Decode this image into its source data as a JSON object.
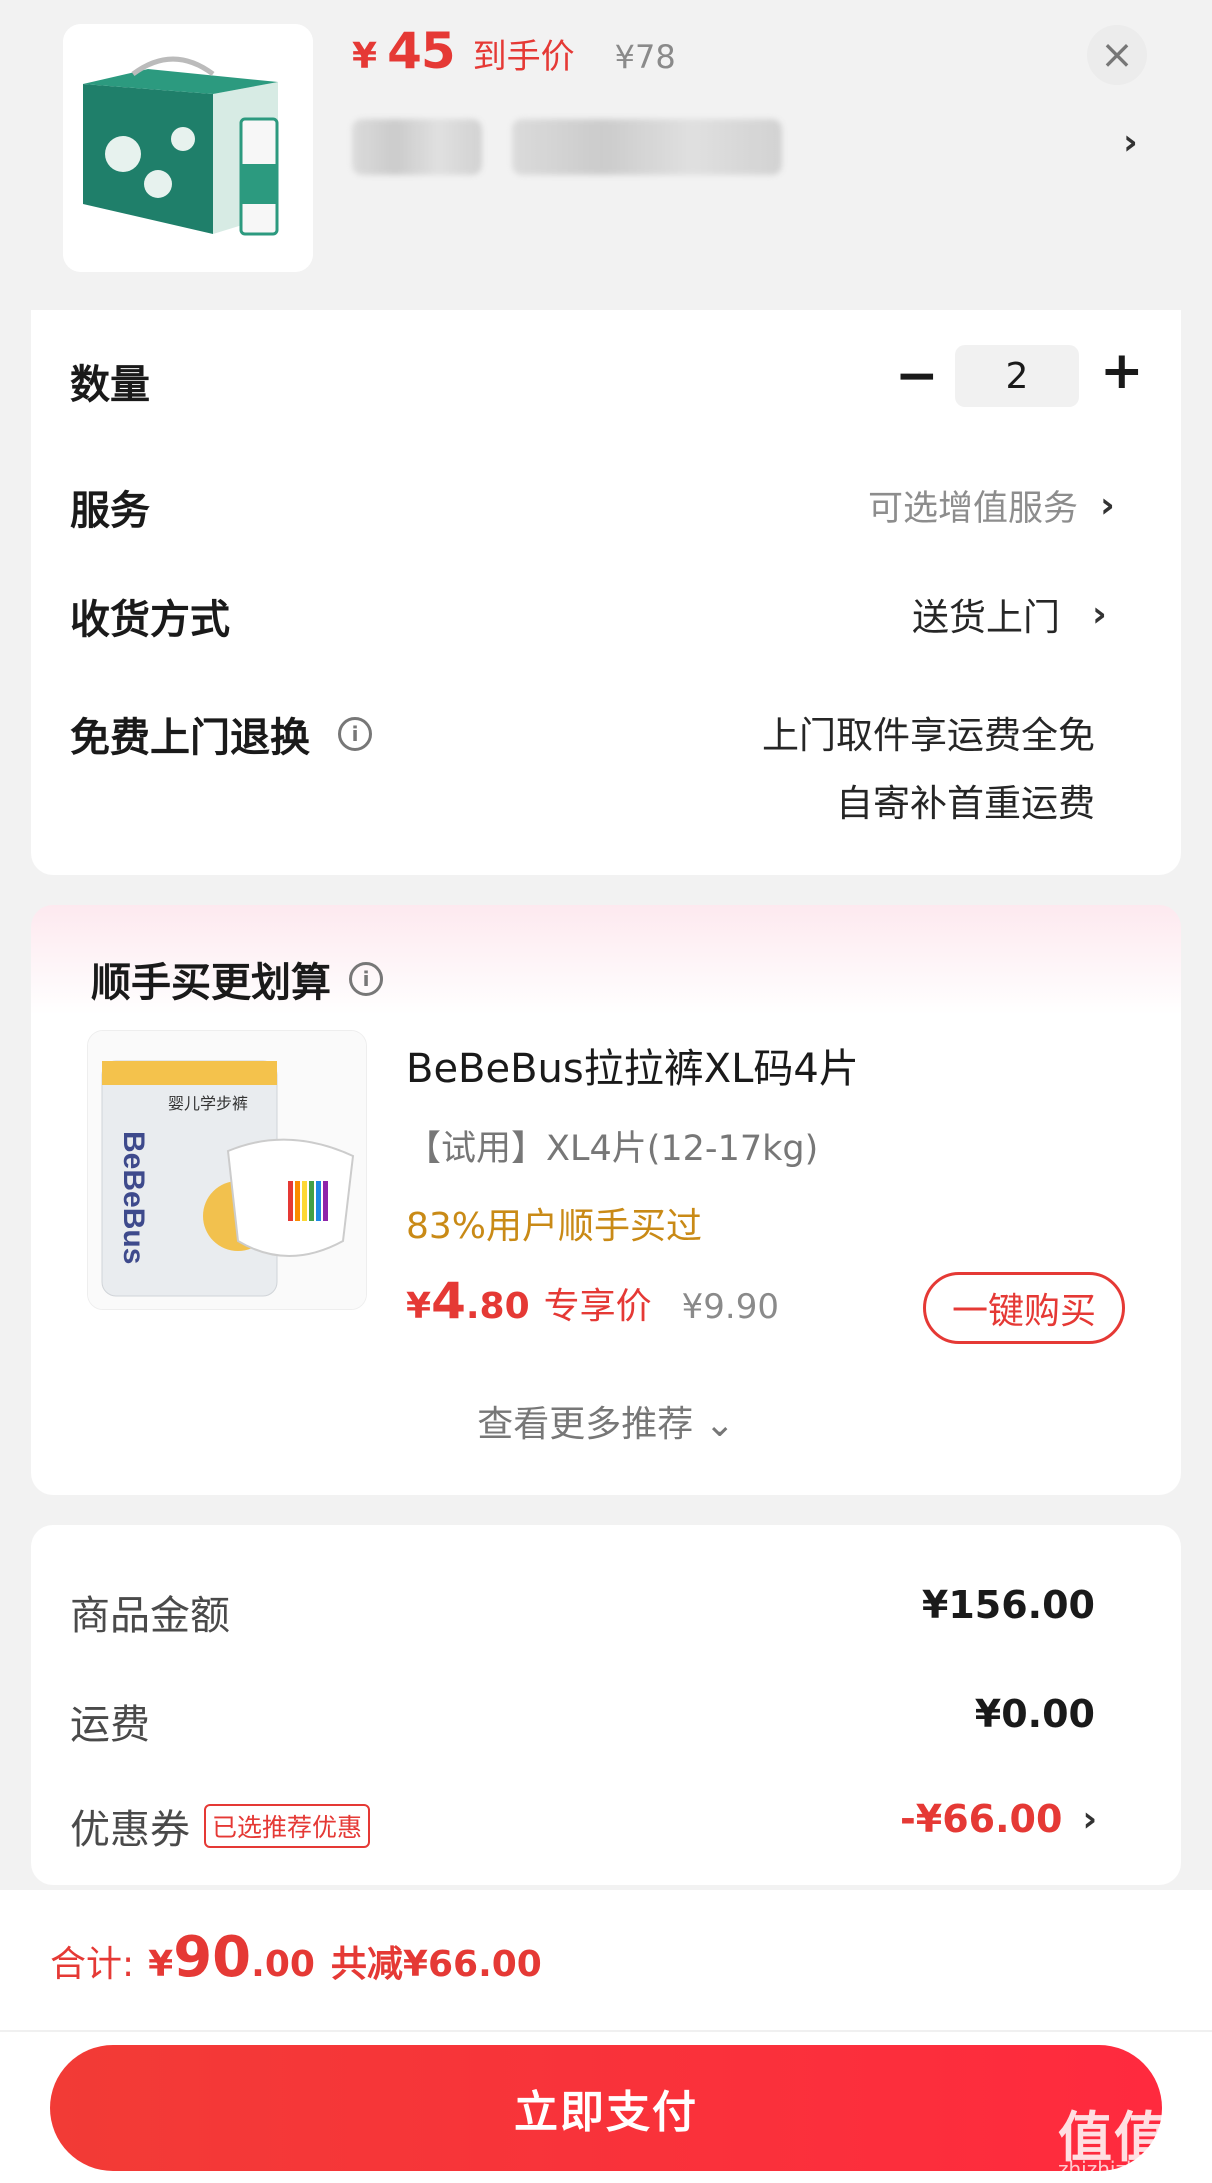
{
  "product": {
    "price_currency": "¥",
    "price": "45",
    "price_tag": "到手价",
    "original_price": "¥78",
    "close_icon": "close-icon",
    "chevron_icon": "chevron-right-icon"
  },
  "settings": {
    "quantity": {
      "label": "数量",
      "value": "2",
      "minus": "−",
      "plus": "+"
    },
    "service": {
      "label": "服务",
      "hint": "可选增值服务",
      "chevron": "›"
    },
    "delivery": {
      "label": "收货方式",
      "value": "送货上门",
      "chevron": "›"
    },
    "return": {
      "label": "免费上门退换",
      "line1": "上门取件享运费全免",
      "line2": "自寄补首重运费",
      "info": "i"
    }
  },
  "recommend": {
    "title": "顺手买更划算",
    "info": "i",
    "item": {
      "name": "BeBeBus拉拉裤XL码4片",
      "spec": "【试用】XL4片(12-17kg)",
      "users": "83%用户顺手买过",
      "price_cur": "¥",
      "price_int": "4",
      "price_dec": ".80",
      "price_tag": "专享价",
      "original_price": "¥9.90",
      "buy_label": "一键购买",
      "package_text_brand": "BeBeBus",
      "package_text_cn": "婴儿学步裤"
    },
    "more": "查看更多推荐 ⌄"
  },
  "amounts": {
    "goods": {
      "label": "商品金额",
      "value": "¥156.00"
    },
    "shipping": {
      "label": "运费",
      "value": "¥0.00"
    },
    "coupon": {
      "label": "优惠券",
      "badge": "已选推荐优惠",
      "value": "-¥66.00",
      "chevron": "›"
    }
  },
  "bottom": {
    "total_label": "合计:",
    "total_cur": "¥",
    "total_int": "90",
    "total_dec": ".00",
    "saved": "共减¥66.00",
    "pay_label": "立即支付",
    "watermark": "值值值",
    "watermark_sub": "zhizhizhi.com"
  },
  "colors": {
    "accent_red": "#e53935",
    "gold": "#c98a16"
  }
}
